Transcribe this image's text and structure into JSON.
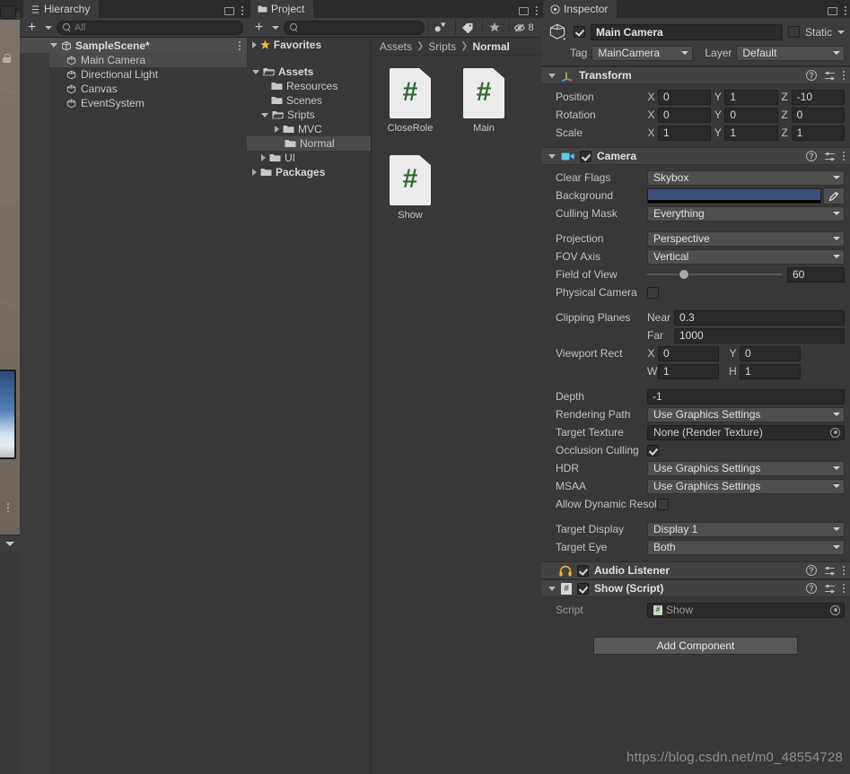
{
  "hierarchy": {
    "tab_label": "Hierarchy",
    "search_placeholder": "All",
    "scene_name": "SampleScene*",
    "objects": [
      {
        "label": "Main Camera",
        "selected": true
      },
      {
        "label": "Directional Light",
        "selected": false
      },
      {
        "label": "Canvas",
        "selected": false
      },
      {
        "label": "EventSystem",
        "selected": false
      }
    ]
  },
  "project": {
    "tab_label": "Project",
    "search_placeholder": "",
    "hidden_count": "8",
    "tree": [
      {
        "label": "Favorites",
        "depth": 0,
        "icon": "star-icon",
        "arrow": "right",
        "bold": true,
        "selected": false
      },
      {
        "label": "",
        "depth": 0,
        "icon": "none",
        "arrow": "none",
        "bold": false,
        "selected": false
      },
      {
        "label": "Assets",
        "depth": 0,
        "icon": "folder-open-icon",
        "arrow": "down",
        "bold": true,
        "selected": false
      },
      {
        "label": "Resources",
        "depth": 1,
        "icon": "folder-icon",
        "arrow": "none",
        "bold": false,
        "selected": false
      },
      {
        "label": "Scenes",
        "depth": 1,
        "icon": "folder-icon",
        "arrow": "none",
        "bold": false,
        "selected": false
      },
      {
        "label": "Sripts",
        "depth": 1,
        "icon": "folder-open-icon",
        "arrow": "down",
        "bold": false,
        "selected": false
      },
      {
        "label": "MVC",
        "depth": 2,
        "icon": "folder-icon",
        "arrow": "right",
        "bold": false,
        "selected": false
      },
      {
        "label": "Normal",
        "depth": 2,
        "icon": "folder-icon",
        "arrow": "none",
        "bold": false,
        "selected": true
      },
      {
        "label": "UI",
        "depth": 1,
        "icon": "folder-icon",
        "arrow": "right",
        "bold": false,
        "selected": false
      },
      {
        "label": "Packages",
        "depth": 0,
        "icon": "folder-icon",
        "arrow": "right",
        "bold": true,
        "selected": false
      }
    ],
    "breadcrumb": [
      "Assets",
      "Sripts",
      "Normal"
    ],
    "assets": [
      {
        "label": "CloseRole",
        "icon": "csharp-script-icon"
      },
      {
        "label": "Main",
        "icon": "csharp-script-icon"
      },
      {
        "label": "Show",
        "icon": "csharp-script-icon"
      }
    ]
  },
  "inspector": {
    "tab_label": "Inspector",
    "object_name": "Main Camera",
    "object_enabled": true,
    "static_label": "Static",
    "static_checked": false,
    "tag_label": "Tag",
    "tag_value": "MainCamera",
    "layer_label": "Layer",
    "layer_value": "Default",
    "components": [
      {
        "title": "Transform",
        "icon": "transform-axis-icon",
        "has_checkbox": false,
        "expanded": true
      },
      {
        "title": "Camera",
        "icon": "camera-icon",
        "has_checkbox": true,
        "checked": true,
        "expanded": true
      },
      {
        "title": "Audio Listener",
        "icon": "headphones-icon",
        "has_checkbox": true,
        "checked": true,
        "expanded": false
      },
      {
        "title": "Show (Script)",
        "icon": "csharp-script-icon",
        "has_checkbox": true,
        "checked": true,
        "expanded": true
      }
    ],
    "transform": {
      "position": {
        "label": "Position",
        "x": "0",
        "y": "1",
        "z": "-10"
      },
      "rotation": {
        "label": "Rotation",
        "x": "0",
        "y": "0",
        "z": "0"
      },
      "scale": {
        "label": "Scale",
        "x": "1",
        "y": "1",
        "z": "1"
      },
      "axis_labels": [
        "X",
        "Y",
        "Z"
      ]
    },
    "camera": {
      "clear_flags": {
        "label": "Clear Flags",
        "value": "Skybox"
      },
      "background": {
        "label": "Background",
        "color": "#39507d",
        "alpha_color": "#000000"
      },
      "culling_mask": {
        "label": "Culling Mask",
        "value": "Everything"
      },
      "projection": {
        "label": "Projection",
        "value": "Perspective"
      },
      "fov_axis": {
        "label": "FOV Axis",
        "value": "Vertical"
      },
      "field_of_view": {
        "label": "Field of View",
        "value": "60",
        "slider_pct": 27
      },
      "physical_camera": {
        "label": "Physical Camera",
        "checked": false
      },
      "clipping_planes": {
        "label": "Clipping Planes",
        "near_label": "Near",
        "near": "0.3",
        "far_label": "Far",
        "far": "1000"
      },
      "viewport_rect": {
        "label": "Viewport Rect",
        "x_label": "X",
        "x": "0",
        "y_label": "Y",
        "y": "0",
        "w_label": "W",
        "w": "1",
        "h_label": "H",
        "h": "1"
      },
      "depth": {
        "label": "Depth",
        "value": "-1"
      },
      "rendering_path": {
        "label": "Rendering Path",
        "value": "Use Graphics Settings"
      },
      "target_texture": {
        "label": "Target Texture",
        "value": "None (Render Texture)"
      },
      "occlusion_culling": {
        "label": "Occlusion Culling",
        "checked": true
      },
      "hdr": {
        "label": "HDR",
        "value": "Use Graphics Settings"
      },
      "msaa": {
        "label": "MSAA",
        "value": "Use Graphics Settings"
      },
      "allow_dynamic_resolution": {
        "label": "Allow Dynamic Resol",
        "checked": false
      },
      "target_display": {
        "label": "Target Display",
        "value": "Display 1"
      },
      "target_eye": {
        "label": "Target Eye",
        "value": "Both"
      }
    },
    "show_script": {
      "script_label": "Script",
      "script_value": "Show"
    },
    "add_component_label": "Add Component"
  },
  "watermark": "https://blog.csdn.net/m0_48554728"
}
